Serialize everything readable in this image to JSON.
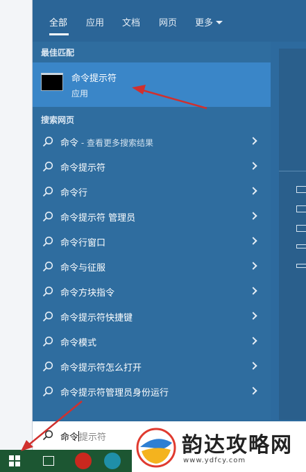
{
  "tabs": [
    {
      "label": "全部",
      "active": true
    },
    {
      "label": "应用"
    },
    {
      "label": "文档"
    },
    {
      "label": "网页"
    },
    {
      "label": "更多"
    }
  ],
  "best_match": {
    "section_label": "最佳匹配",
    "title": "命令提示符",
    "subtitle": "应用"
  },
  "web_search": {
    "section_label": "搜索网页",
    "items": [
      {
        "label": "命令",
        "hint": " - 查看更多搜索结果"
      },
      {
        "label": "命令提示符",
        "hint": ""
      },
      {
        "label": "命令行",
        "hint": ""
      },
      {
        "label": "命令提示符 管理员",
        "hint": ""
      },
      {
        "label": "命令行窗口",
        "hint": ""
      },
      {
        "label": "命令与征服",
        "hint": ""
      },
      {
        "label": "命令方块指令",
        "hint": ""
      },
      {
        "label": "命令提示符快捷键",
        "hint": ""
      },
      {
        "label": "命令模式",
        "hint": ""
      },
      {
        "label": "命令提示符怎么打开",
        "hint": ""
      },
      {
        "label": "命令提示符管理员身份运行",
        "hint": ""
      }
    ]
  },
  "search_box": {
    "typed": "命令",
    "autocomplete": "提示符"
  },
  "watermark": {
    "title": "韵达攻略网",
    "url": "www.ydfcy.com"
  },
  "colors": {
    "panel": "#2d6a9e",
    "highlight": "#3a86c8",
    "taskbar": "#1c5632",
    "arrow": "#d0302e"
  }
}
